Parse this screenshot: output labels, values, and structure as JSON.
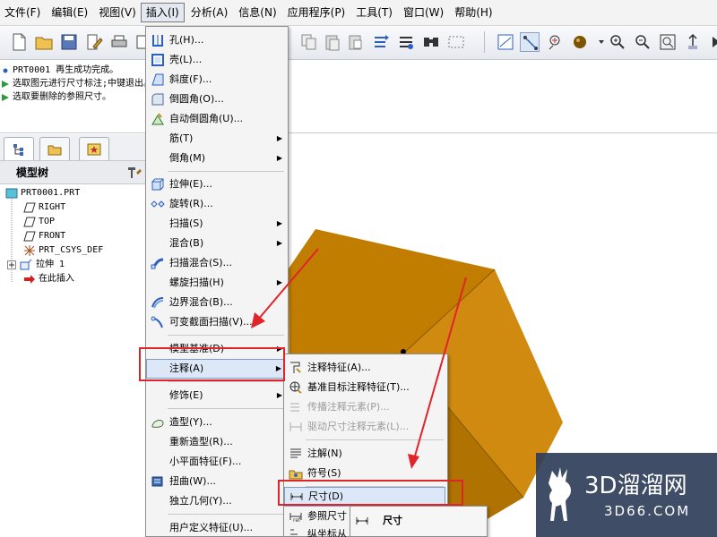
{
  "menubar": {
    "items": [
      "文件(F)",
      "编辑(E)",
      "视图(V)",
      "插入(I)",
      "分析(A)",
      "信息(N)",
      "应用程序(P)",
      "工具(T)",
      "窗口(W)",
      "帮助(H)"
    ]
  },
  "messages": [
    "PRT0001 再生成功完成。",
    "选取图元进行尺寸标注;中键退出。",
    "选取要删除的参照尺寸。"
  ],
  "navigator": {
    "header": "模型树",
    "tree": [
      "PRT0001.PRT",
      "RIGHT",
      "TOP",
      "FRONT",
      "PRT_CSYS_DEF",
      "拉伸 1",
      "在此插入"
    ]
  },
  "insert_menu": {
    "items": [
      {
        "label": "孔(H)...",
        "icon": "hole-icon"
      },
      {
        "label": "壳(L)...",
        "icon": "shell-icon"
      },
      {
        "label": "斜度(F)...",
        "icon": "draft-icon"
      },
      {
        "label": "倒圆角(O)...",
        "icon": "round-icon"
      },
      {
        "label": "自动倒圆角(U)...",
        "icon": "auto-round-icon"
      },
      {
        "label": "筋(T)",
        "icon": ""
      },
      {
        "label": "倒角(M)",
        "icon": ""
      },
      {
        "label": "拉伸(E)...",
        "icon": "extrude-icon"
      },
      {
        "label": "旋转(R)...",
        "icon": "revolve-icon"
      },
      {
        "label": "扫描(S)",
        "icon": ""
      },
      {
        "label": "混合(B)",
        "icon": ""
      },
      {
        "label": "扫描混合(S)...",
        "icon": "swept-blend-icon"
      },
      {
        "label": "螺旋扫描(H)",
        "icon": ""
      },
      {
        "label": "边界混合(B)...",
        "icon": "boundary-blend-icon"
      },
      {
        "label": "可变截面扫描(V)...",
        "icon": "variable-section-sweep-icon"
      },
      {
        "label": "模型基准(D)",
        "icon": ""
      },
      {
        "label": "注释(A)",
        "icon": ""
      },
      {
        "label": "修饰(E)",
        "icon": ""
      },
      {
        "label": "造型(Y)...",
        "icon": "style-icon"
      },
      {
        "label": "重新造型(R)...",
        "icon": ""
      },
      {
        "label": "小平面特征(F)...",
        "icon": ""
      },
      {
        "label": "扭曲(W)...",
        "icon": "warp-icon"
      },
      {
        "label": "独立几何(Y)...",
        "icon": ""
      },
      {
        "label": "用户定义特征(U)...",
        "icon": ""
      }
    ]
  },
  "annotation_menu": {
    "items": [
      {
        "label": "注释特征(A)...",
        "icon": "annotation-feature-icon"
      },
      {
        "label": "基准目标注释特征(T)...",
        "icon": "datum-target-icon"
      },
      {
        "label": "传播注释元素(P)...",
        "icon": "propagate-icon"
      },
      {
        "label": "驱动尺寸注释元素(L)...",
        "icon": "driving-dimension-icon"
      },
      {
        "label": "注解(N)",
        "icon": "note-icon"
      },
      {
        "label": "符号(S)",
        "icon": "symbol-icon"
      },
      {
        "label": "尺寸(D)",
        "icon": "dimension-icon"
      },
      {
        "label": "参照尺寸",
        "icon": "reference-dimension-icon"
      },
      {
        "label": "纵坐标从",
        "icon": "ordinate-icon"
      }
    ]
  },
  "dimension_submenu": {
    "item": "尺寸"
  },
  "watermark": {
    "title": "3D溜溜网",
    "subtitle": "3D66.COM"
  },
  "colors": {
    "model_top": "#c07d00",
    "model_front": "#b07200",
    "model_side": "#d08a10",
    "highlight": "#e0242a",
    "menu_hover": "#dce8f8"
  }
}
